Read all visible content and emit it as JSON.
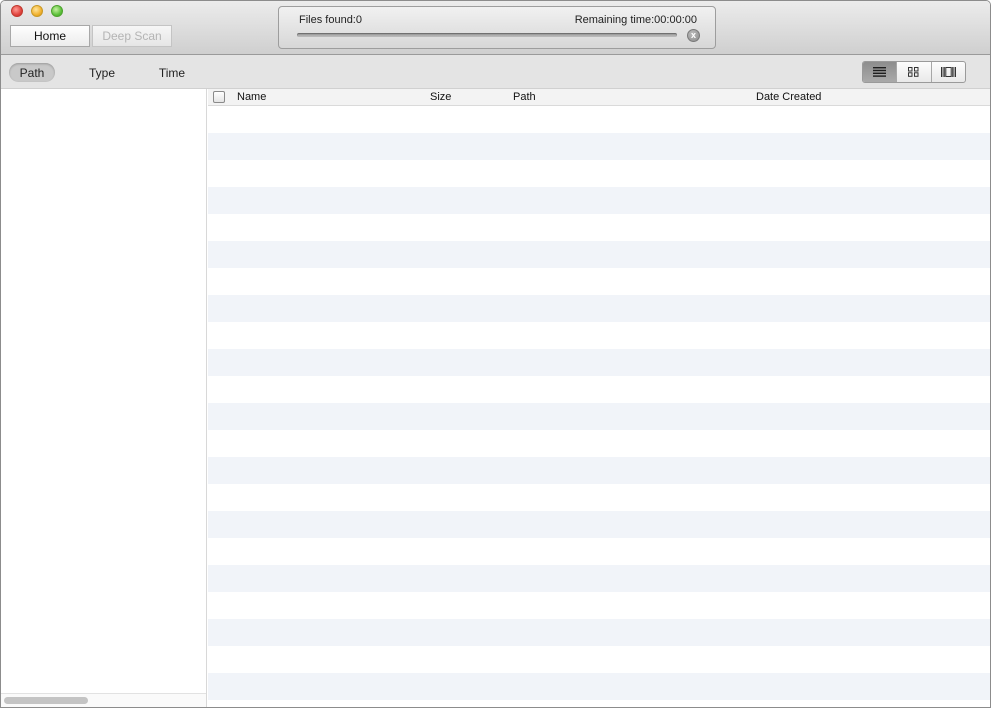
{
  "toolbar": {
    "home_label": "Home",
    "deep_scan_label": "Deep Scan"
  },
  "scan_status": {
    "files_found": "Files found:0",
    "remaining_time": "Remaining time:00:00:00",
    "progress": 0,
    "cancel_glyph": "x"
  },
  "filter_tabs": [
    {
      "label": "Path",
      "selected": true
    },
    {
      "label": "Type"
    },
    {
      "label": "Time"
    }
  ],
  "view_modes": [
    {
      "icon": "list-view-icon",
      "selected": true
    },
    {
      "icon": "grid-view-icon"
    },
    {
      "icon": "coverflow-view-icon"
    }
  ],
  "table": {
    "columns": [
      "Name",
      "Size",
      "Path",
      "Date Created"
    ],
    "rows": []
  },
  "colors": {
    "row_alt": "#f1f4f9",
    "selected_segment": "#c9c9c9"
  }
}
